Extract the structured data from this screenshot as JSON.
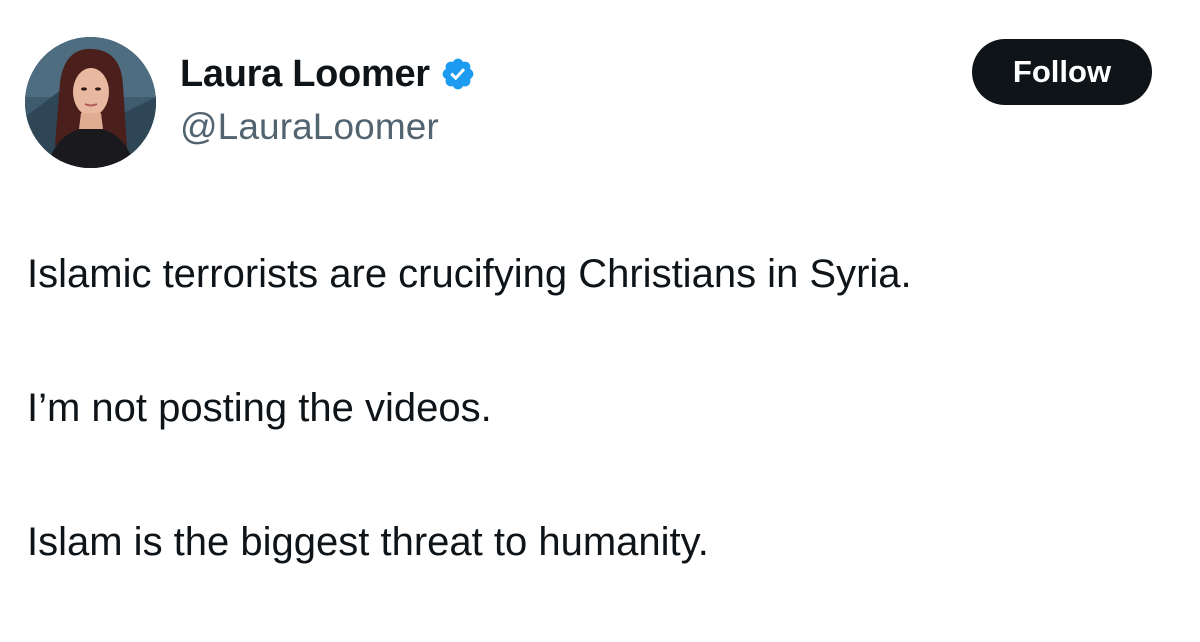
{
  "author": {
    "display_name": "Laura Loomer",
    "handle": "@LauraLoomer",
    "verified_icon": "verified-badge-icon",
    "avatar_icon": "profile-photo"
  },
  "actions": {
    "follow_label": "Follow"
  },
  "tweet": {
    "lines": [
      "Islamic terrorists are crucifying Christians in Syria.",
      "I’m not posting the videos.",
      "Islam is the biggest threat to humanity."
    ]
  },
  "colors": {
    "text": "#0f1419",
    "handle": "#536471",
    "verified": "#1d9bf0",
    "follow_bg": "#0f1419",
    "follow_text": "#ffffff",
    "background": "#ffffff"
  }
}
